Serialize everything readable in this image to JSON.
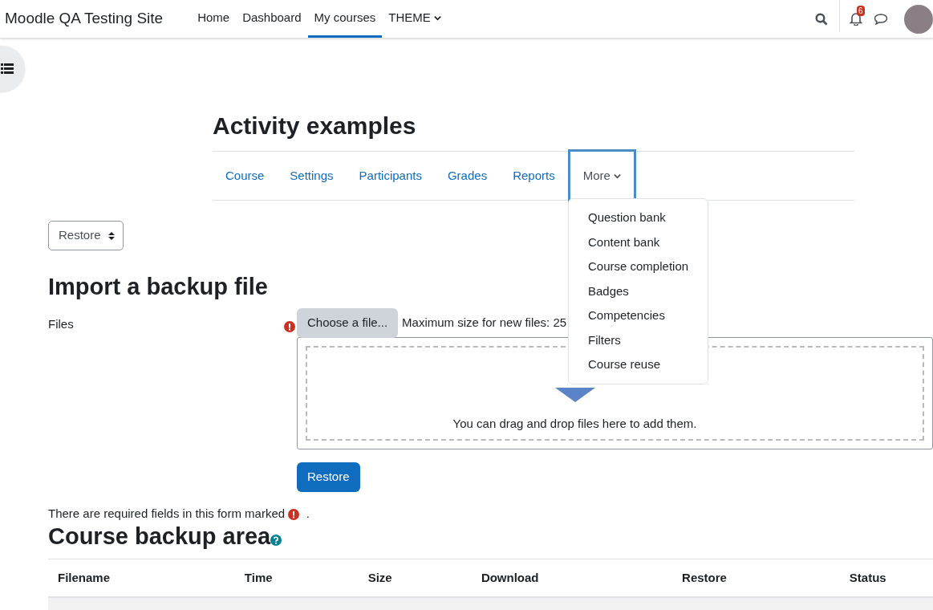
{
  "site_name": "Moodle QA Testing Site",
  "primary_nav": [
    {
      "label": "Home",
      "selected": false,
      "dropdown": false
    },
    {
      "label": "Dashboard",
      "selected": false,
      "dropdown": false
    },
    {
      "label": "My courses",
      "selected": true,
      "dropdown": false
    },
    {
      "label": "THEME",
      "selected": false,
      "dropdown": true
    }
  ],
  "notification_count": "6",
  "course_title": "Activity examples",
  "secondary_nav": [
    {
      "label": "Course",
      "dropdown": false,
      "focused": false
    },
    {
      "label": "Settings",
      "dropdown": false,
      "focused": false
    },
    {
      "label": "Participants",
      "dropdown": false,
      "focused": false
    },
    {
      "label": "Grades",
      "dropdown": false,
      "focused": false
    },
    {
      "label": "Reports",
      "dropdown": false,
      "focused": false
    },
    {
      "label": "More",
      "dropdown": true,
      "focused": true
    }
  ],
  "more_menu": [
    "Question bank",
    "Content bank",
    "Course completion",
    "Badges",
    "Competencies",
    "Filters",
    "Course reuse"
  ],
  "action_select": "Restore",
  "import_heading": "Import a backup file",
  "files_label": "Files",
  "choose_file_button": "Choose a file...",
  "max_size_text": "Maximum size for new files: 25",
  "drop_text": "You can drag and drop files here to add them.",
  "restore_button": "Restore",
  "required_note": {
    "before": "There are required fields in this form marked",
    "after": "."
  },
  "backup_heading": "Course backup area",
  "table": {
    "columns": [
      "Filename",
      "Time",
      "Size",
      "Download",
      "Restore",
      "Status"
    ]
  }
}
